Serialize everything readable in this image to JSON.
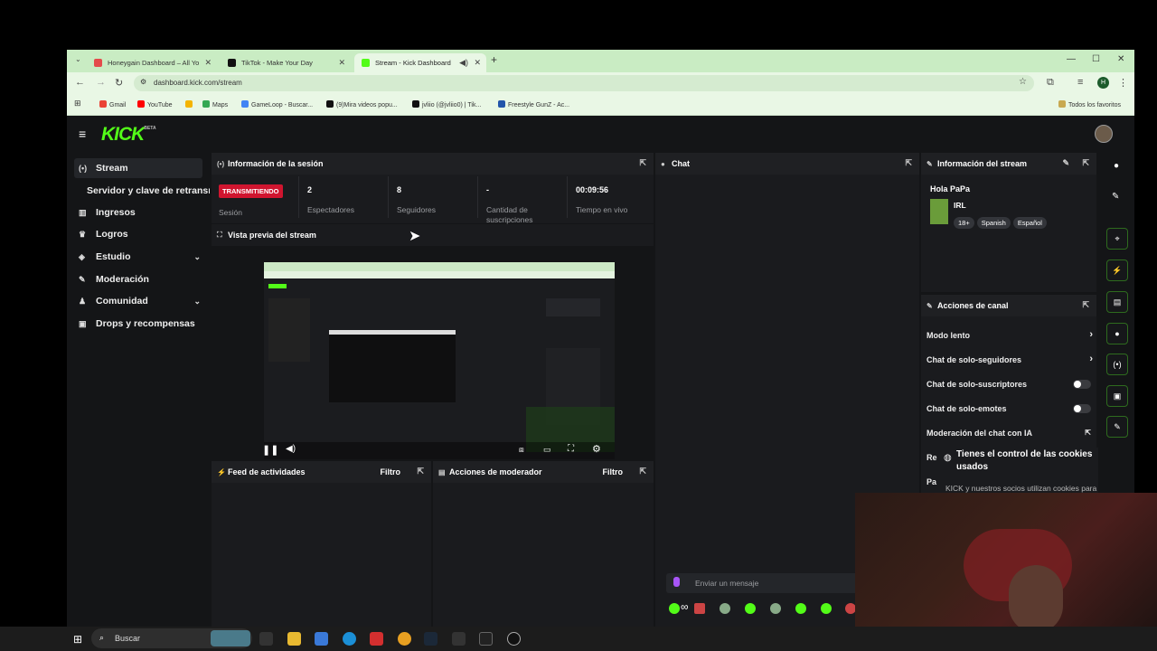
{
  "browser": {
    "tabs": [
      {
        "label": "Honeygain Dashboard – All Yo",
        "color": "#e44b4b"
      },
      {
        "label": "TikTok - Make Your Day",
        "color": "#111111"
      },
      {
        "label": "Stream - Kick Dashboard",
        "color": "#53fc18"
      }
    ],
    "url": "dashboard.kick.com/stream",
    "profile_initial": "H",
    "bookmarks": [
      {
        "label": "Gmail",
        "color": "#ea4335"
      },
      {
        "label": "YouTube",
        "color": "#ff0000"
      },
      {
        "label": "",
        "color": "#f4b400"
      },
      {
        "label": "Maps",
        "color": "#34a853"
      },
      {
        "label": "GameLoop - Buscar...",
        "color": "#4285f4"
      },
      {
        "label": "(9)Mira videos popu...",
        "color": "#111111"
      },
      {
        "label": "jvliio (@jvliio0) | Tik...",
        "color": "#111111"
      },
      {
        "label": "Freestyle GunZ - Ac...",
        "color": "#2255aa"
      }
    ],
    "all_bookmarks_label": "Todos los favoritos"
  },
  "app": {
    "logo": "KICK",
    "logo_sup": "BETA",
    "sidebar": [
      {
        "label": "Stream",
        "icon": "broadcast-icon",
        "glyph": "(•)",
        "active": true
      },
      {
        "label": "Servidor y clave de retransm",
        "icon": "",
        "glyph": ""
      },
      {
        "label": "Ingresos",
        "icon": "chart-icon",
        "glyph": "▥"
      },
      {
        "label": "Logros",
        "icon": "trophy-icon",
        "glyph": "♛"
      },
      {
        "label": "Estudio",
        "icon": "layers-icon",
        "glyph": "◈",
        "expand": true
      },
      {
        "label": "Moderación",
        "icon": "wrench-icon",
        "glyph": "✎"
      },
      {
        "label": "Comunidad",
        "icon": "users-icon",
        "glyph": "♟",
        "expand": true
      },
      {
        "label": "Drops y recompensas",
        "icon": "gift-icon",
        "glyph": "▣"
      }
    ],
    "session": {
      "title": "Información de la sesión",
      "badge": "TRANSMITIENDO",
      "stats": [
        {
          "value": "",
          "label": "Sesión"
        },
        {
          "value": "2",
          "label": "Espectadores"
        },
        {
          "value": "8",
          "label": "Seguidores"
        },
        {
          "value": "-",
          "label": "Cantidad de suscripciones"
        },
        {
          "value": "00:09:56",
          "label": "Tiempo en vivo"
        }
      ]
    },
    "preview": {
      "title": "Vista previa del stream"
    },
    "activity": {
      "title": "Feed de actividades",
      "filter": "Filtro"
    },
    "mod_actions": {
      "title": "Acciones de moderador",
      "filter": "Filtro"
    },
    "chat": {
      "title": "Chat",
      "placeholder": "Enviar un mensaje",
      "extra": "∞"
    },
    "stream_info": {
      "title": "Información del stream",
      "stream_title": "Hola PaPa",
      "category": "IRL",
      "tags": [
        "18+",
        "Spanish",
        "Español"
      ]
    },
    "channel_actions": {
      "title": "Acciones de canal",
      "items": [
        {
          "label": "Modo lento",
          "control": "arrow"
        },
        {
          "label": "Chat de solo-seguidores",
          "control": "arrow"
        },
        {
          "label": "Chat de solo-suscriptores",
          "control": "toggle"
        },
        {
          "label": "Chat de solo-emotes",
          "control": "toggle"
        },
        {
          "label": "Moderación del chat con IA",
          "control": "link"
        }
      ],
      "partial": [
        "Re",
        "Pa"
      ]
    },
    "cookies": {
      "title": "Tienes el control de las cookies usados",
      "text": "KICK y nuestros socios utilizan cookies para"
    }
  },
  "taskbar": {
    "search": "Buscar"
  },
  "colors": {
    "accent": "#53fc18",
    "live": "#d0152f"
  }
}
